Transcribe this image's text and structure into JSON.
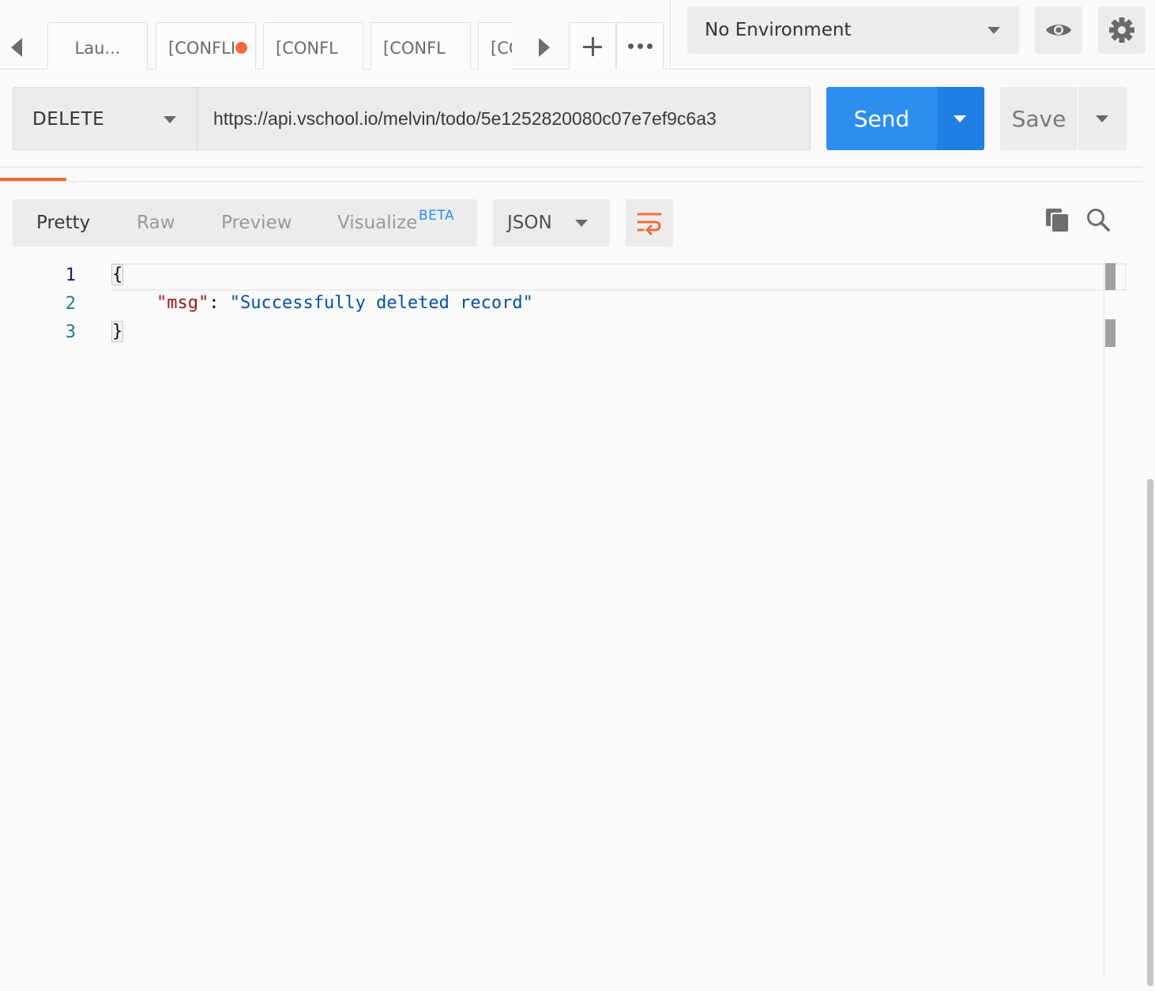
{
  "tabbar": {
    "tabs": [
      {
        "label": "Lau...",
        "unsaved": false
      },
      {
        "label": "[CONFLI",
        "unsaved": true
      },
      {
        "label": "[CONFL",
        "unsaved": false
      },
      {
        "label": "[CONFL",
        "unsaved": false
      },
      {
        "label": "[CO",
        "unsaved": false
      }
    ]
  },
  "environment": {
    "selected": "No Environment"
  },
  "request": {
    "method": "DELETE",
    "url": "https://api.vschool.io/melvin/todo/5e1252820080c07e7ef9c6a3",
    "send_label": "Send",
    "save_label": "Save"
  },
  "response": {
    "view_tabs": [
      {
        "label": "Pretty",
        "active": true
      },
      {
        "label": "Raw",
        "active": false
      },
      {
        "label": "Preview",
        "active": false
      },
      {
        "label": "Visualize",
        "active": false
      }
    ],
    "beta_badge": "BETA",
    "format": "JSON",
    "line_numbers": [
      "1",
      "2",
      "3"
    ],
    "body": {
      "open_brace": "{",
      "key": "\"msg\"",
      "colon": ": ",
      "value": "\"Successfully deleted record\"",
      "close_brace": "}"
    }
  },
  "colors": {
    "accent_orange": "#f26b3a",
    "send_blue": "#2d8ef0",
    "json_key": "#a31515",
    "json_string": "#0451a5",
    "line_number": "#237893"
  }
}
